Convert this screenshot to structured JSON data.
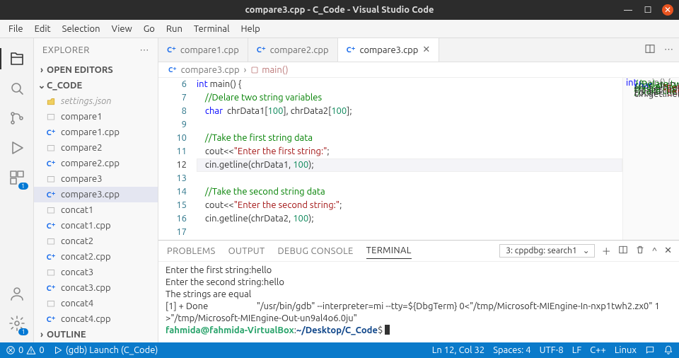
{
  "window": {
    "title": "compare3.cpp - C_Code - Visual Studio Code"
  },
  "menu": [
    "File",
    "Edit",
    "Selection",
    "View",
    "Go",
    "Run",
    "Terminal",
    "Help"
  ],
  "sidebar": {
    "title": "EXPLORER",
    "openEditors": "OPEN EDITORS",
    "folder": "C_CODE",
    "outline": "OUTLINE",
    "files": [
      {
        "name": "settings.json",
        "kind": "dim"
      },
      {
        "name": "compare1",
        "kind": "folder"
      },
      {
        "name": "compare1.cpp",
        "kind": "cpp"
      },
      {
        "name": "compare2",
        "kind": "folder"
      },
      {
        "name": "compare2.cpp",
        "kind": "cpp"
      },
      {
        "name": "compare3",
        "kind": "folder"
      },
      {
        "name": "compare3.cpp",
        "kind": "cpp",
        "active": true
      },
      {
        "name": "concat1",
        "kind": "folder"
      },
      {
        "name": "concat1.cpp",
        "kind": "cpp"
      },
      {
        "name": "concat2",
        "kind": "folder"
      },
      {
        "name": "concat2.cpp",
        "kind": "cpp"
      },
      {
        "name": "concat3",
        "kind": "folder"
      },
      {
        "name": "concat3.cpp",
        "kind": "cpp"
      },
      {
        "name": "concat4",
        "kind": "folder"
      },
      {
        "name": "concat4.cpp",
        "kind": "cpp"
      }
    ]
  },
  "tabs": [
    {
      "label": "compare1.cpp"
    },
    {
      "label": "compare2.cpp"
    },
    {
      "label": "compare3.cpp",
      "active": true
    }
  ],
  "breadcrumb": {
    "file": "compare3.cpp",
    "symbol": "main()"
  },
  "code": {
    "start": 6,
    "current": 12,
    "lines": [
      {
        "t": "int",
        "c": "kw",
        "r": " main() {"
      },
      {
        "indent": "    ",
        "t": "//Delare two string variables",
        "c": "cm"
      },
      {
        "indent": "    ",
        "seg": [
          {
            "t": "char",
            "c": "kw"
          },
          {
            "t": "  chrData1[",
            "c": "ident"
          },
          {
            "t": "100",
            "c": "num"
          },
          {
            "t": "], chrData2[",
            "c": "ident"
          },
          {
            "t": "100",
            "c": "num"
          },
          {
            "t": "];",
            "c": "ident"
          }
        ]
      },
      {
        "t": ""
      },
      {
        "indent": "    ",
        "t": "//Take the first string data",
        "c": "cm"
      },
      {
        "indent": "    ",
        "seg": [
          {
            "t": "cout<<",
            "c": "ident"
          },
          {
            "t": "\"Enter the first string:\"",
            "c": "str"
          },
          {
            "t": ";",
            "c": "ident"
          }
        ]
      },
      {
        "indent": "    ",
        "seg": [
          {
            "t": "cin.getline(chrData1, ",
            "c": "ident"
          },
          {
            "t": "100",
            "c": "num"
          },
          {
            "t": ");",
            "c": "ident"
          }
        ]
      },
      {
        "t": ""
      },
      {
        "indent": "    ",
        "t": "//Take the second string data",
        "c": "cm"
      },
      {
        "indent": "    ",
        "seg": [
          {
            "t": "cout<<",
            "c": "ident"
          },
          {
            "t": "\"Enter the second string:\"",
            "c": "str"
          },
          {
            "t": ";",
            "c": "ident"
          }
        ]
      },
      {
        "indent": "    ",
        "seg": [
          {
            "t": "cin.getline(chrData2, ",
            "c": "ident"
          },
          {
            "t": "100",
            "c": "num"
          },
          {
            "t": ");",
            "c": "ident"
          }
        ]
      },
      {
        "t": ""
      },
      {
        "t": ""
      }
    ]
  },
  "panel": {
    "tabs": [
      "PROBLEMS",
      "OUTPUT",
      "DEBUG CONSOLE",
      "TERMINAL"
    ],
    "active": "TERMINAL",
    "task": "3: cppdbg: search1",
    "lines": [
      "Enter the first string:hello",
      "Enter the second string:hello",
      "The strings are equal",
      "[1] + Done                       \"/usr/bin/gdb\" --interpreter=mi --tty=${DbgTerm} 0<\"/tmp/Microsoft-MIEngine-In-nxp1twh2.zx0\" 1>\"/tmp/Microsoft-MIEngine-Out-un9al4o6.0ju\""
    ],
    "prompt": {
      "user": "fahmida@fahmida-VirtualBox",
      "cwd": "~/Desktop/C_Code"
    }
  },
  "status": {
    "errors": "0",
    "warnings": "0",
    "debug": "(gdb) Launch (C_Code)",
    "lncol": "Ln 12, Col 32",
    "spaces": "Spaces: 4",
    "encoding": "UTF-8",
    "eol": "LF",
    "lang": "C++",
    "os": "Linux"
  }
}
